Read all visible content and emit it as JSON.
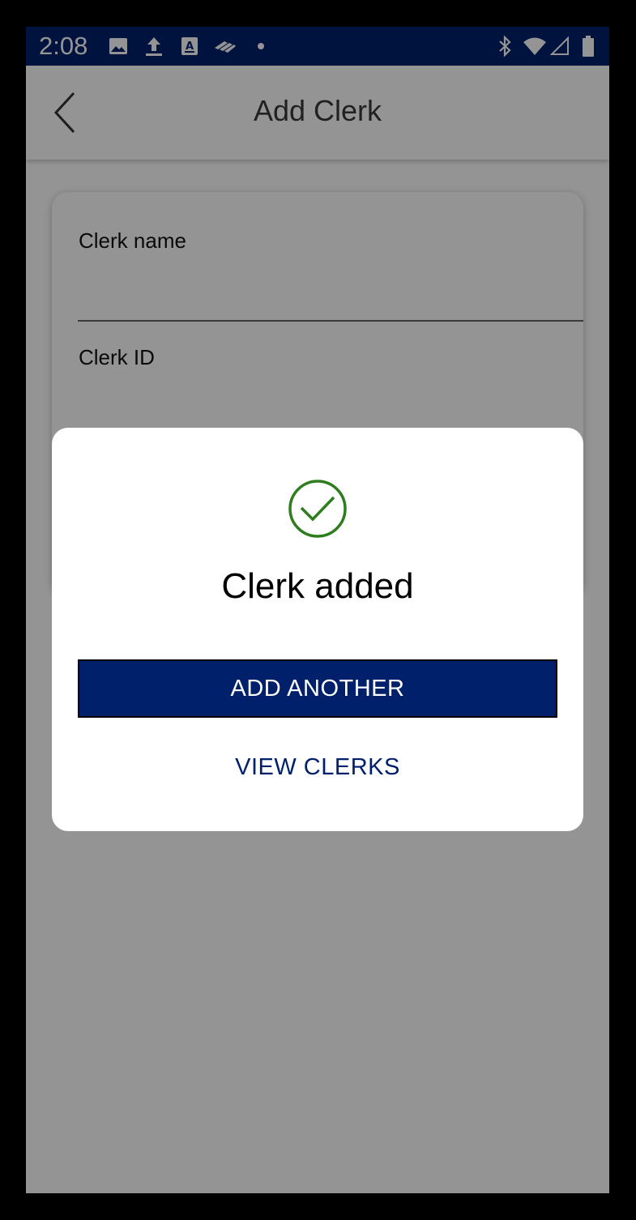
{
  "status_bar": {
    "time": "2:08",
    "left_icons": [
      "image-icon",
      "upload-icon",
      "app-a-icon",
      "bank-logo-icon",
      "dot-icon"
    ],
    "right_icons": [
      "bluetooth-icon",
      "wifi-icon",
      "signal-icon",
      "battery-icon"
    ],
    "background": "#00206b"
  },
  "app_bar": {
    "title": "Add Clerk",
    "back_icon": "chevron-left-icon"
  },
  "form": {
    "fields": [
      {
        "label": "Clerk name",
        "value": ""
      },
      {
        "label": "Clerk ID",
        "value": ""
      }
    ]
  },
  "dialog": {
    "icon": "check-circle-icon",
    "icon_color": "#2e7d1f",
    "title": "Clerk added",
    "primary_button": "ADD ANOTHER",
    "secondary_button": "VIEW CLERKS",
    "accent_color": "#00206b"
  }
}
